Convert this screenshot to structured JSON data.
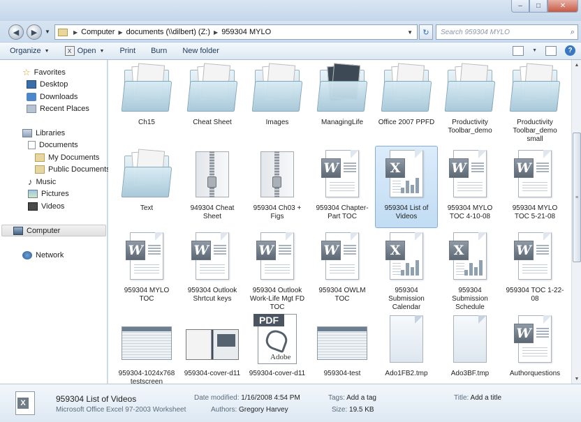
{
  "window": {
    "minimize_label": "–",
    "maximize_label": "□",
    "close_label": "✕"
  },
  "nav": {
    "back_glyph": "◀",
    "forward_glyph": "▶",
    "refresh_glyph": "↻",
    "search_placeholder": "Search 959304 MYLO",
    "search_icon_glyph": "⌕"
  },
  "address": {
    "crumbs": [
      "Computer",
      "documents (\\\\dilbert) (Z:)",
      "959304 MYLO"
    ]
  },
  "toolbar": {
    "organize": "Organize",
    "open": "Open",
    "print": "Print",
    "burn": "Burn",
    "new_folder": "New folder",
    "help_glyph": "?"
  },
  "sidebar": {
    "favorites": "Favorites",
    "desktop": "Desktop",
    "downloads": "Downloads",
    "recent_places": "Recent Places",
    "libraries": "Libraries",
    "documents": "Documents",
    "my_documents": "My Documents",
    "public_documents": "Public Documents",
    "music": "Music",
    "pictures": "Pictures",
    "videos": "Videos",
    "computer": "Computer",
    "network": "Network"
  },
  "files": [
    {
      "name": "Ch15",
      "kind": "folder"
    },
    {
      "name": "Cheat Sheet",
      "kind": "folder"
    },
    {
      "name": "Images",
      "kind": "folder"
    },
    {
      "name": "ManagingLife",
      "kind": "folder"
    },
    {
      "name": "Office 2007 PPFD",
      "kind": "folder"
    },
    {
      "name": "Productivity Toolbar_demo",
      "kind": "folder"
    },
    {
      "name": "Productivity Toolbar_demo small",
      "kind": "folder"
    },
    {
      "name": "Text",
      "kind": "folder"
    },
    {
      "name": "949304 Cheat Sheet",
      "kind": "zip"
    },
    {
      "name": "959304 Ch03 + Figs",
      "kind": "zip"
    },
    {
      "name": "959304 Chapter-Part TOC",
      "kind": "word"
    },
    {
      "name": "959304 List of Videos",
      "kind": "excel",
      "selected": true
    },
    {
      "name": "959304 MYLO TOC 4-10-08",
      "kind": "word"
    },
    {
      "name": "959304 MYLO TOC 5-21-08",
      "kind": "word"
    },
    {
      "name": "959304 MYLO TOC",
      "kind": "word"
    },
    {
      "name": "959304 Outlook Shrtcut keys",
      "kind": "word"
    },
    {
      "name": "959304 Outlook Work-Life Mgt FD TOC",
      "kind": "word"
    },
    {
      "name": "959304 OWLM TOC",
      "kind": "word"
    },
    {
      "name": "959304 Submission Calendar",
      "kind": "excel"
    },
    {
      "name": "959304 Submission Schedule",
      "kind": "excel"
    },
    {
      "name": "959304 TOC 1-22-08",
      "kind": "word"
    },
    {
      "name": "959304-1024x768 testscreen",
      "kind": "screenshot"
    },
    {
      "name": "959304-cover-d11",
      "kind": "cover"
    },
    {
      "name": "959304-cover-d11",
      "kind": "pdf"
    },
    {
      "name": "959304-test",
      "kind": "screenshot"
    },
    {
      "name": "Ado1FB2.tmp",
      "kind": "tmp"
    },
    {
      "name": "Ado3BF.tmp",
      "kind": "tmp"
    },
    {
      "name": "Authorquestions",
      "kind": "word"
    }
  ],
  "thumb_text": {
    "pdf_banner": "PDF",
    "pdf_brand": "Adobe",
    "word_letter": "W",
    "excel_letter": "X"
  },
  "details": {
    "title": "959304 List of  Videos",
    "type": "Microsoft Office Excel 97-2003 Worksheet",
    "date_modified_label": "Date modified:",
    "date_modified": "1/16/2008 4:54 PM",
    "authors_label": "Authors:",
    "authors": "Gregory Harvey",
    "tags_label": "Tags:",
    "tags": "Add a tag",
    "size_label": "Size:",
    "size": "19.5 KB",
    "title_label": "Title:",
    "title_value": "Add a title"
  }
}
